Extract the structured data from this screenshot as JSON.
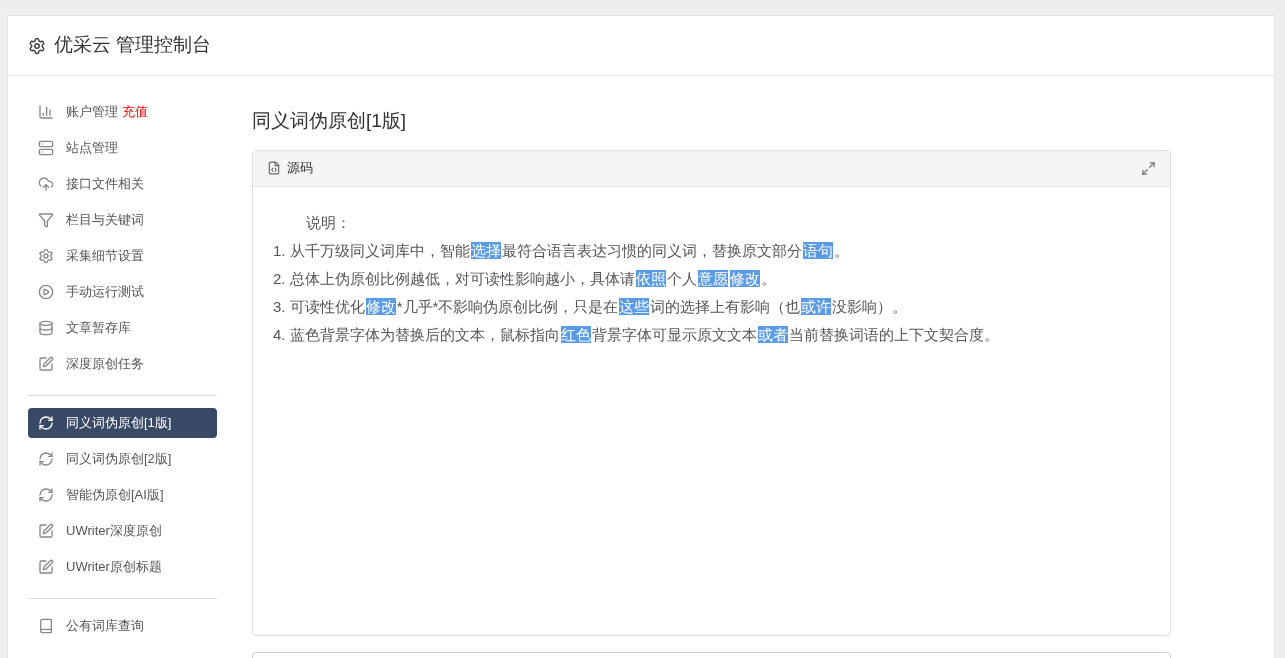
{
  "header": {
    "title": "优采云 管理控制台"
  },
  "sidebar": {
    "groups": [
      [
        {
          "label": "账户管理",
          "badge": "充值",
          "selected": false
        },
        {
          "label": "站点管理",
          "selected": false
        },
        {
          "label": "接口文件相关",
          "selected": false
        },
        {
          "label": "栏目与关键词",
          "selected": false
        },
        {
          "label": "采集细节设置",
          "selected": false
        },
        {
          "label": "手动运行测试",
          "selected": false
        },
        {
          "label": "文章暂存库",
          "selected": false
        },
        {
          "label": "深度原创任务",
          "selected": false
        }
      ],
      [
        {
          "label": "同义词伪原创[1版]",
          "selected": true
        },
        {
          "label": "同义词伪原创[2版]",
          "selected": false
        },
        {
          "label": "智能伪原创[AI版]",
          "selected": false
        },
        {
          "label": "UWriter深度原创",
          "selected": false
        },
        {
          "label": "UWriter原创标题",
          "selected": false
        }
      ],
      [
        {
          "label": "公有词库查询",
          "selected": false
        }
      ]
    ]
  },
  "page_title": "同义词伪原创[1版]",
  "panel": {
    "title": "源码",
    "heading": "说明：",
    "lines": [
      [
        {
          "text": "1. 从千万级同义词库中，智能",
          "highlighted": false
        },
        {
          "text": "选择",
          "highlighted": true
        },
        {
          "text": "最符合语言表达习惯的同义词，替换原文部分",
          "highlighted": false
        },
        {
          "text": "语句",
          "highlighted": true
        },
        {
          "text": "。",
          "highlighted": false
        }
      ],
      [
        {
          "text": "2. 总体上伪原创比例越低，对可读性影响越小，具体请",
          "highlighted": false
        },
        {
          "text": "依照",
          "highlighted": true
        },
        {
          "text": "个人",
          "highlighted": false
        },
        {
          "text": "意愿",
          "highlighted": true
        },
        {
          "text": "修改",
          "highlighted": true
        },
        {
          "text": "。",
          "highlighted": false
        }
      ],
      [
        {
          "text": "3. 可读性优化",
          "highlighted": false
        },
        {
          "text": "修改",
          "highlighted": true
        },
        {
          "text": "*几乎*不影响伪原创比例，只是在",
          "highlighted": false
        },
        {
          "text": "这些",
          "highlighted": true
        },
        {
          "text": "词的选择上有影响（也",
          "highlighted": false
        },
        {
          "text": "或许",
          "highlighted": true
        },
        {
          "text": "没影响）。",
          "highlighted": false
        }
      ],
      [
        {
          "text": "4. 蓝色背景字体为替换后的文本，鼠标指向",
          "highlighted": false
        },
        {
          "text": "红色",
          "highlighted": true
        },
        {
          "text": "背景字体可显示原文文本",
          "highlighted": false
        },
        {
          "text": "或者",
          "highlighted": true
        },
        {
          "text": "当前替换词语的上下文契合度。",
          "highlighted": false
        }
      ]
    ]
  }
}
